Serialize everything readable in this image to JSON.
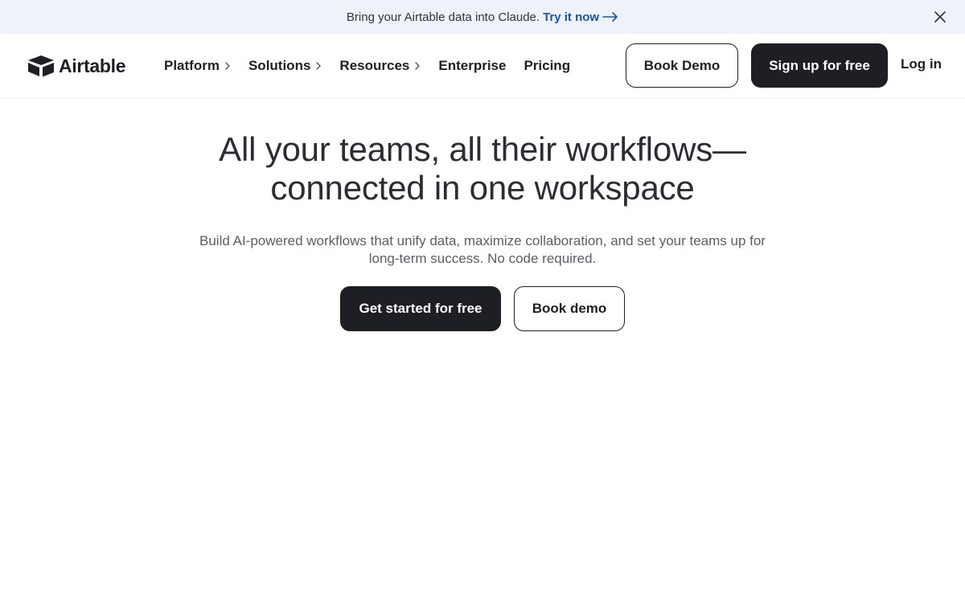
{
  "banner": {
    "message": "Bring your Airtable data into Claude.",
    "cta": "Try it now",
    "icons": {
      "arrow": "arrow-right-icon",
      "close": "close-icon"
    }
  },
  "nav": {
    "logo_text": "Airtable",
    "logo_icon": "airtable-box-logo",
    "menu": [
      {
        "label": "Platform",
        "has_submenu": true
      },
      {
        "label": "Solutions",
        "has_submenu": true
      },
      {
        "label": "Resources",
        "has_submenu": true
      },
      {
        "label": "Enterprise",
        "has_submenu": false
      },
      {
        "label": "Pricing",
        "has_submenu": false
      }
    ],
    "book_demo": "Book Demo",
    "sign_up": "Sign up for free",
    "log_in": "Log in"
  },
  "hero": {
    "title_line1": "All your teams, all their workflows—",
    "title_line2": "connected in one workspace",
    "subtitle_line1": "Build AI-powered workflows that unify data, maximize collaboration, and set your teams up for",
    "subtitle_line2": "long-term success. No code required.",
    "primary_cta": "Get started for free",
    "secondary_cta": "Book demo"
  },
  "colors": {
    "banner_bg": "#eef3fb",
    "link_blue": "#1f51a8",
    "dark": "#1d1f25",
    "text_muted": "#5b5e66"
  }
}
